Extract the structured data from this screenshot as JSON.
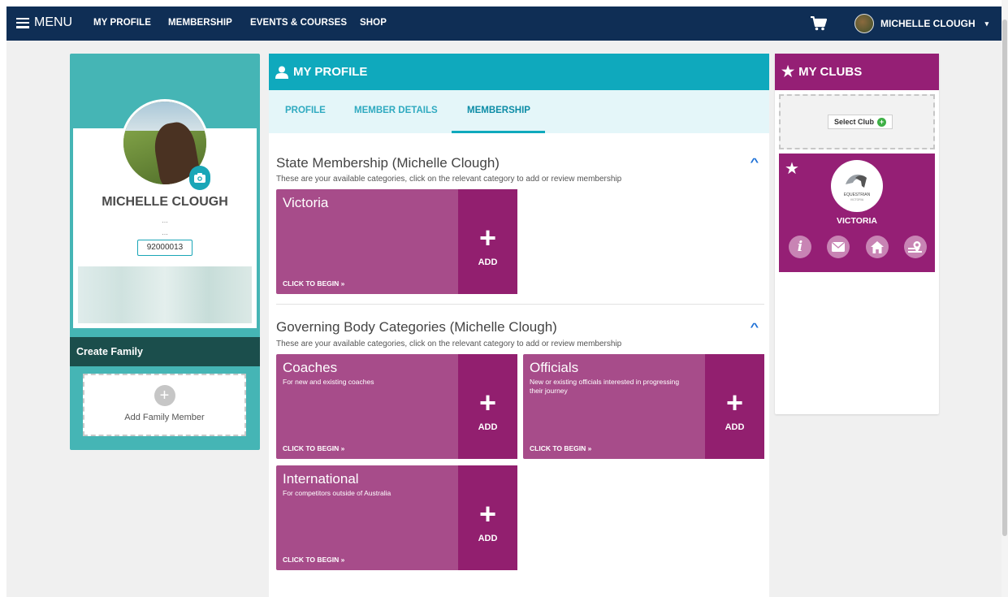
{
  "nav": {
    "menu_label": "MENU",
    "links": [
      "MY PROFILE",
      "MEMBERSHIP",
      "EVENTS & COURSES",
      "SHOP"
    ],
    "user_name": "MICHELLE CLOUGH",
    "caret": "▾"
  },
  "profile": {
    "name": "MICHELLE CLOUGH",
    "line1": "...",
    "line2": "...",
    "member_number": "92000013"
  },
  "family": {
    "heading": "Create Family",
    "add_label": "Add Family Member",
    "add_symbol": "+"
  },
  "main": {
    "heading": "MY PROFILE",
    "tabs": [
      "PROFILE",
      "MEMBER DETAILS",
      "MEMBERSHIP"
    ],
    "active_tab": "MEMBERSHIP",
    "chevron": "^",
    "state_section": {
      "title": "State Membership (Michelle Clough)",
      "subtitle": "These are your available categories, click on the relevant category to add or review membership",
      "cards": [
        {
          "title": "Victoria",
          "desc": "",
          "begin": "CLICK TO BEGIN »",
          "add": "ADD",
          "plus": "+"
        }
      ]
    },
    "gov_section": {
      "title": "Governing Body Categories (Michelle Clough)",
      "subtitle": "These are your available categories, click on the relevant category to add or review membership",
      "cards": [
        {
          "title": "Coaches",
          "desc": "For new and existing coaches",
          "begin": "CLICK TO BEGIN »",
          "add": "ADD",
          "plus": "+"
        },
        {
          "title": "Officials",
          "desc": "New or existing officials interested in progressing their journey",
          "begin": "CLICK TO BEGIN »",
          "add": "ADD",
          "plus": "+"
        },
        {
          "title": "International",
          "desc": "For competitors outside of Australia",
          "begin": "CLICK TO BEGIN »",
          "add": "ADD",
          "plus": "+"
        }
      ]
    }
  },
  "clubs": {
    "heading": "MY CLUBS",
    "select_label": "Select Club",
    "select_plus": "+",
    "club_name": "VICTORIA",
    "logo_text": "EQUESTRIAN",
    "logo_sub": "VICTORIA",
    "star": "★",
    "info_glyph": "i"
  },
  "colors": {
    "nav_bg": "#0f2e55",
    "teal": "#0fa9bd",
    "left_teal": "#45b5b5",
    "card_magenta": "#a74c8a",
    "card_add_magenta": "#921f6f",
    "clubs_magenta": "#951f75"
  }
}
